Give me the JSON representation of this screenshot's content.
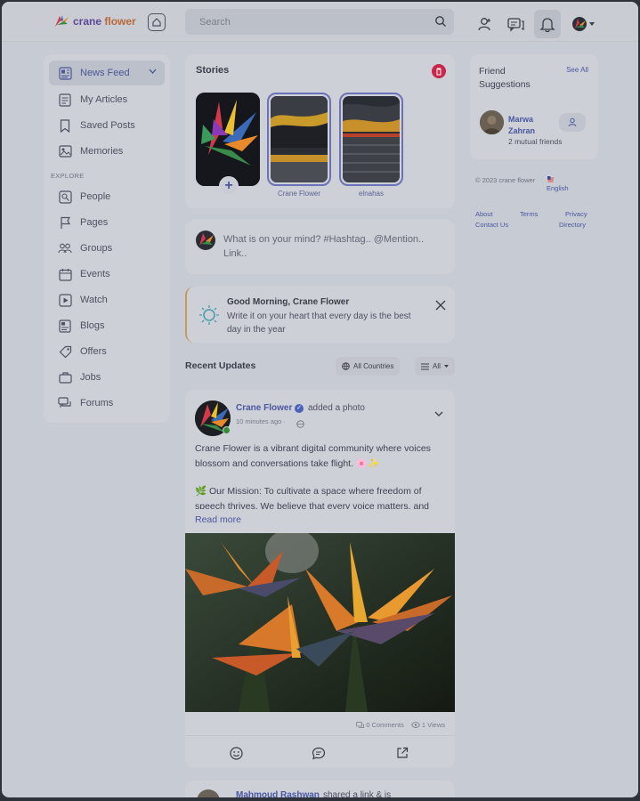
{
  "header": {
    "logo_text_1": "crane",
    "logo_text_2": "flower",
    "search_placeholder": "Search"
  },
  "sidebar": {
    "items": [
      {
        "label": "News Feed",
        "icon": "newspaper-icon"
      },
      {
        "label": "My Articles",
        "icon": "article-icon"
      },
      {
        "label": "Saved Posts",
        "icon": "bookmark-icon"
      },
      {
        "label": "Memories",
        "icon": "memories-icon"
      }
    ],
    "explore_label": "EXPLORE",
    "explore_items": [
      {
        "label": "People",
        "icon": "people-icon"
      },
      {
        "label": "Pages",
        "icon": "flag-icon"
      },
      {
        "label": "Groups",
        "icon": "groups-icon"
      },
      {
        "label": "Events",
        "icon": "calendar-icon"
      },
      {
        "label": "Watch",
        "icon": "video-icon"
      },
      {
        "label": "Blogs",
        "icon": "blog-icon"
      },
      {
        "label": "Offers",
        "icon": "tag-icon"
      },
      {
        "label": "Jobs",
        "icon": "briefcase-icon"
      },
      {
        "label": "Forums",
        "icon": "forum-icon"
      }
    ]
  },
  "stories": {
    "title": "Stories",
    "items": [
      {
        "label": "Crane Flower"
      },
      {
        "label": "elnahas"
      }
    ]
  },
  "composer": {
    "placeholder": "What is on your mind? #Hashtag.. @Mention.. Link.."
  },
  "greeting": {
    "title": "Good Morning, Crane Flower",
    "message": "Write it on your heart that every day is the best day in the year"
  },
  "recent_updates": {
    "title": "Recent Updates",
    "filter_countries": "All Countries",
    "filter_all": "All"
  },
  "post": {
    "author": "Crane Flower",
    "action": "added a photo",
    "time": "10 minutes ago ·",
    "body_1": "Crane Flower is a vibrant digital community where voices blossom and conversations take flight. 🌸✨",
    "body_2": "🌿 Our Mission: To cultivate a space where freedom of speech thrives. We believe that every voice matters, and",
    "read_more": "Read more",
    "comments": "0 Comments",
    "views": "1 Views"
  },
  "post2": {
    "author": "Mahmoud Rashwan",
    "action": "shared a link & is"
  },
  "friends": {
    "title": "Friend Suggestions",
    "see_all": "See All",
    "name": "Marwa Zahran",
    "mutual": "2 mutual friends"
  },
  "footer": {
    "copyright": "© 2023 crane flower",
    "language": "English",
    "about": "About",
    "terms": "Terms",
    "privacy": "Privacy",
    "contact": "Contact Us",
    "directory": "Directory"
  }
}
